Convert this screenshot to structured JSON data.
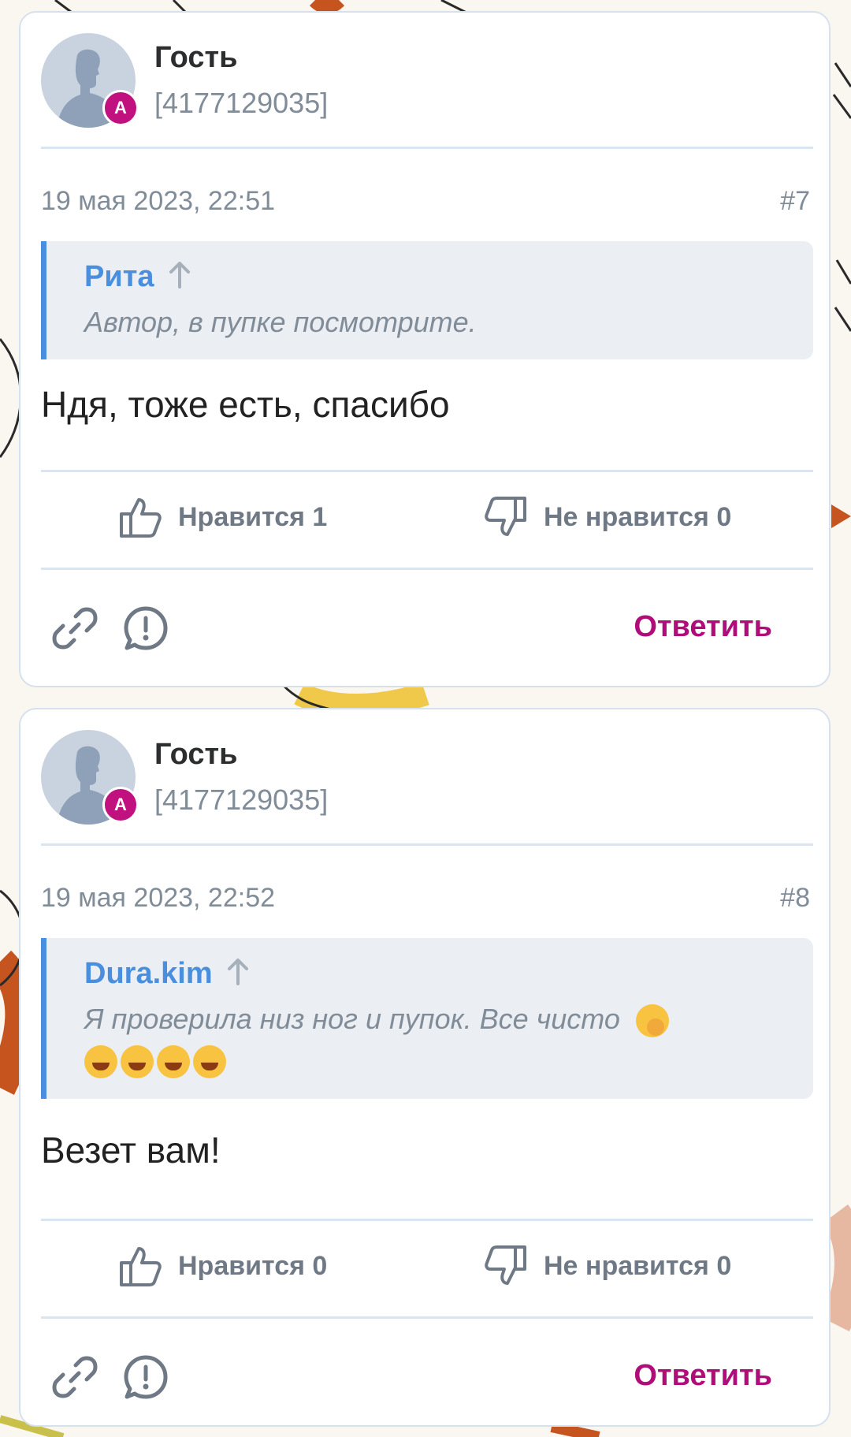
{
  "posts": [
    {
      "author": "Гость",
      "author_id": "[4177129035]",
      "role_badge": "A",
      "date": "19 мая 2023, 22:51",
      "number": "#7",
      "quote": {
        "author": "Рита",
        "text": "Автор, в пупке посмотрите.",
        "emoji": []
      },
      "text": "Ндя, тоже есть, спасибо",
      "likes_label": "Нравится 1",
      "dislikes_label": "Не нравится 0",
      "reply_label": "Ответить"
    },
    {
      "author": "Гость",
      "author_id": "[4177129035]",
      "role_badge": "A",
      "date": "19 мая 2023, 22:52",
      "number": "#8",
      "quote": {
        "author": "Dura.kim",
        "text": "Я проверила низ ног и пупок. Все чисто",
        "emoji": [
          "🤭",
          "🤣",
          "🤣",
          "🤣",
          "🤣"
        ]
      },
      "text": "Везет вам!",
      "likes_label": "Нравится 0",
      "dislikes_label": "Не нравится 0",
      "reply_label": "Ответить"
    }
  ],
  "colors": {
    "accent": "#c1117e",
    "link": "#4a8ede",
    "muted": "#818c99",
    "card_border": "#d6e1ee"
  },
  "icons": [
    "user-silhouette-icon",
    "arrow-up-icon",
    "thumbs-up-icon",
    "thumbs-down-icon",
    "link-icon",
    "report-icon"
  ]
}
